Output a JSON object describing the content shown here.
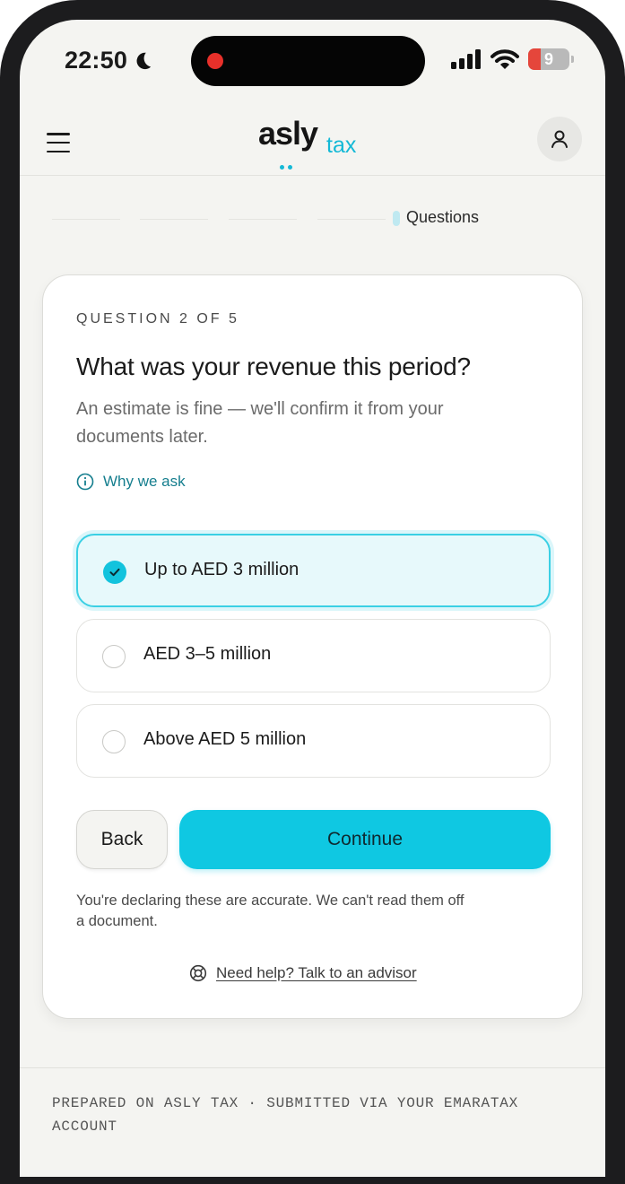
{
  "status_bar": {
    "time": "22:50",
    "battery": "9"
  },
  "header": {
    "logo_main": "asly",
    "logo_sub": "tax"
  },
  "progress": {
    "current_step_label": "Questions"
  },
  "question": {
    "counter": "QUESTION 2 OF 5",
    "title": "What was your revenue this period?",
    "subtitle": "An estimate is fine — we'll confirm it from your documents later.",
    "why_link": "Why we ask",
    "options": [
      {
        "label": "Up to AED 3 million",
        "selected": true
      },
      {
        "label": "AED 3–5 million",
        "selected": false
      },
      {
        "label": "Above AED 5 million",
        "selected": false
      }
    ]
  },
  "actions": {
    "back": "Back",
    "continue": "Continue"
  },
  "declaration": "You're declaring these are accurate. We can't read them off a document.",
  "help_link": "Need help? Talk to an advisor",
  "footer": "PREPARED ON ASLY TAX · SUBMITTED VIA YOUR EMARATAX ACCOUNT",
  "colors": {
    "accent": "#0fc8e2",
    "selected_bg": "#e7f9fb",
    "link": "#157e8e",
    "record_dot": "#e8302a"
  }
}
